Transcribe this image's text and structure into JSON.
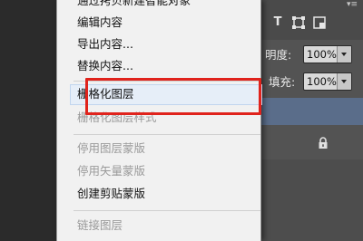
{
  "context_menu": {
    "items": [
      {
        "label": "通过拷贝新建智能对象",
        "enabled": true
      },
      {
        "label": "编辑内容",
        "enabled": true
      },
      {
        "label": "导出内容...",
        "enabled": true
      },
      {
        "label": "替换内容...",
        "enabled": true
      },
      {
        "label": "栅格化图层",
        "enabled": true,
        "highlighted": true
      },
      {
        "label": "栅格化图层样式",
        "enabled": false
      },
      {
        "label": "停用图层蒙版",
        "enabled": false
      },
      {
        "label": "停用矢量蒙版",
        "enabled": false
      },
      {
        "label": "创建剪贴蒙版",
        "enabled": true
      },
      {
        "label": "链接图层",
        "enabled": false
      }
    ],
    "highlight_color": "#e0231c"
  },
  "layers_panel": {
    "filter_icons": [
      "text-filter-icon",
      "shape-filter-icon",
      "smart-object-filter-icon"
    ],
    "opacity": {
      "label": "明度:",
      "value": "100%"
    },
    "fill": {
      "label": "填充:",
      "value": "100%"
    },
    "lock_icon": "lock-icon",
    "selected_layer_color": "#5a6d8a"
  }
}
